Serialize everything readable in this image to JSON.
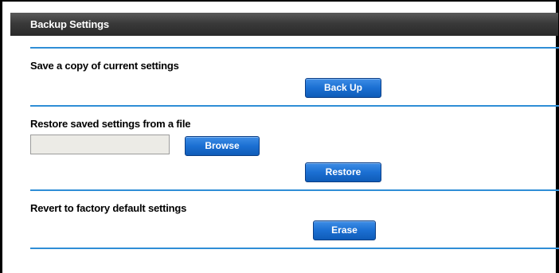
{
  "header": {
    "title": "Backup Settings"
  },
  "sections": {
    "backup": {
      "label": "Save a copy of current settings",
      "button": "Back Up"
    },
    "restore": {
      "label": "Restore saved settings from a file",
      "file_value": "",
      "browse_button": "Browse",
      "restore_button": "Restore"
    },
    "erase": {
      "label": "Revert to factory default settings",
      "button": "Erase"
    }
  },
  "colors": {
    "header_bg": "#3a3a3a",
    "separator": "#2f8ed6",
    "button_bg": "#1b6fd2"
  }
}
